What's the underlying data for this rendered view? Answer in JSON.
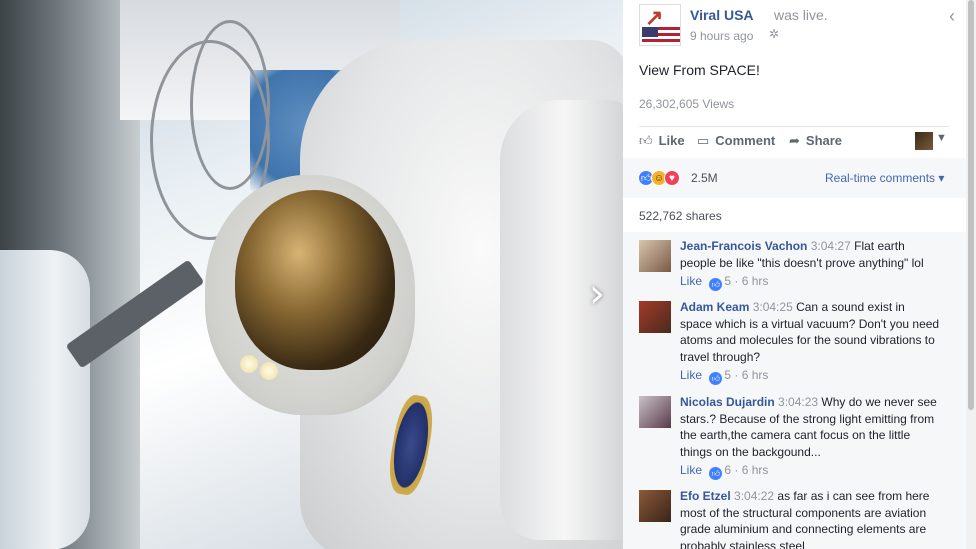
{
  "post": {
    "page_name": "Viral USA",
    "status": "was live.",
    "time": "9 hours ago",
    "privacy_glyph": "✲",
    "text": "View From SPACE!",
    "views": "26,302,605 Views"
  },
  "actions": {
    "like": "Like",
    "comment": "Comment",
    "share": "Share"
  },
  "reactions": {
    "count": "2.5M",
    "realtime_label": "Real-time comments ▾"
  },
  "shares": "522,762 shares",
  "comments": [
    {
      "name": "Jean-Francois Vachon",
      "time": "3:04:27",
      "text": "Flat earth people be like \"this doesn't prove anything\" lol",
      "like_label": "Like",
      "likes": "5",
      "age": "6 hrs"
    },
    {
      "name": "Adam Keam",
      "time": "3:04:25",
      "text": "Can a sound exist in space which is a virtual vacuum? Don't you need atoms and molecules for the sound vibrations to travel through?",
      "like_label": "Like",
      "likes": "5",
      "age": "6 hrs"
    },
    {
      "name": "Nicolas Dujardin",
      "time": "3:04:23",
      "text": "Why do we never see stars.? Because of the strong light emitting from the earth,the camera cant focus on the little things on the backgound...",
      "like_label": "Like",
      "likes": "6",
      "age": "6 hrs"
    },
    {
      "name": "Efo Etzel",
      "time": "3:04:22",
      "text": "as far as i can see from here most of the structural components are aviation grade aluminium and connecting elements are probably stainless steel",
      "like_label": "",
      "likes": "",
      "age": ""
    }
  ],
  "colors": {
    "link_blue": "#365899",
    "accent_blue": "#4267b2",
    "muted_gray": "#90949c"
  },
  "icons": {
    "next": "chevron-right-icon",
    "back": "chevron-left-icon",
    "privacy": "globe-icon",
    "like": "thumbs-up-icon",
    "comment": "comment-bubble-icon",
    "share": "share-arrow-icon"
  }
}
